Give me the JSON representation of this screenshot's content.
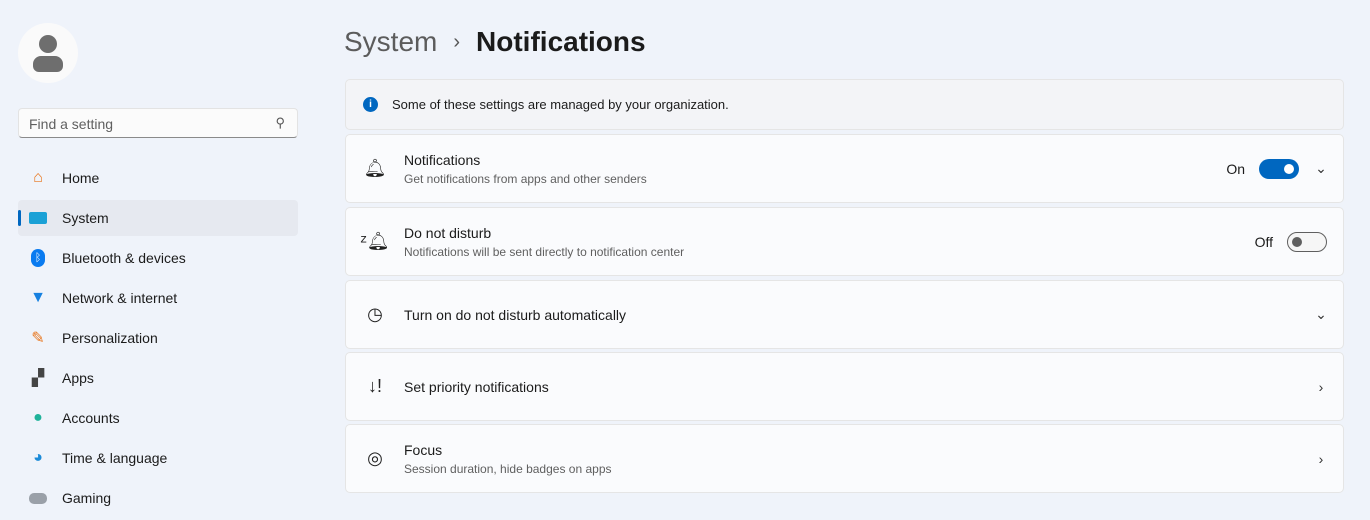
{
  "search": {
    "placeholder": "Find a setting"
  },
  "nav": [
    {
      "label": "Home",
      "icon": "home-icon",
      "glyph": "🏠"
    },
    {
      "label": "System",
      "icon": "system-icon",
      "glyph": "▬",
      "selected": true
    },
    {
      "label": "Bluetooth & devices",
      "icon": "bluetooth-icon",
      "glyph": "ᛒ"
    },
    {
      "label": "Network & internet",
      "icon": "wifi-icon",
      "glyph": "◥"
    },
    {
      "label": "Personalization",
      "icon": "brush-icon",
      "glyph": "🖌"
    },
    {
      "label": "Apps",
      "icon": "apps-icon",
      "glyph": "▦"
    },
    {
      "label": "Accounts",
      "icon": "accounts-icon",
      "glyph": "●"
    },
    {
      "label": "Time & language",
      "icon": "globe-clock-icon",
      "glyph": "◐"
    },
    {
      "label": "Gaming",
      "icon": "gamepad-icon",
      "glyph": "⊕"
    }
  ],
  "breadcrumb": {
    "parent": "System",
    "separator": "›",
    "current": "Notifications"
  },
  "banner": {
    "text": "Some of these settings are managed by your organization."
  },
  "cards": {
    "notifications": {
      "title": "Notifications",
      "subtitle": "Get notifications from apps and other senders",
      "state": "On"
    },
    "dnd": {
      "title": "Do not disturb",
      "subtitle": "Notifications will be sent directly to notification center",
      "state": "Off"
    },
    "auto": {
      "title": "Turn on do not disturb automatically"
    },
    "priority": {
      "title": "Set priority notifications"
    },
    "focus": {
      "title": "Focus",
      "subtitle": "Session duration, hide badges on apps"
    }
  },
  "colors": {
    "accent": "#0067c0"
  }
}
